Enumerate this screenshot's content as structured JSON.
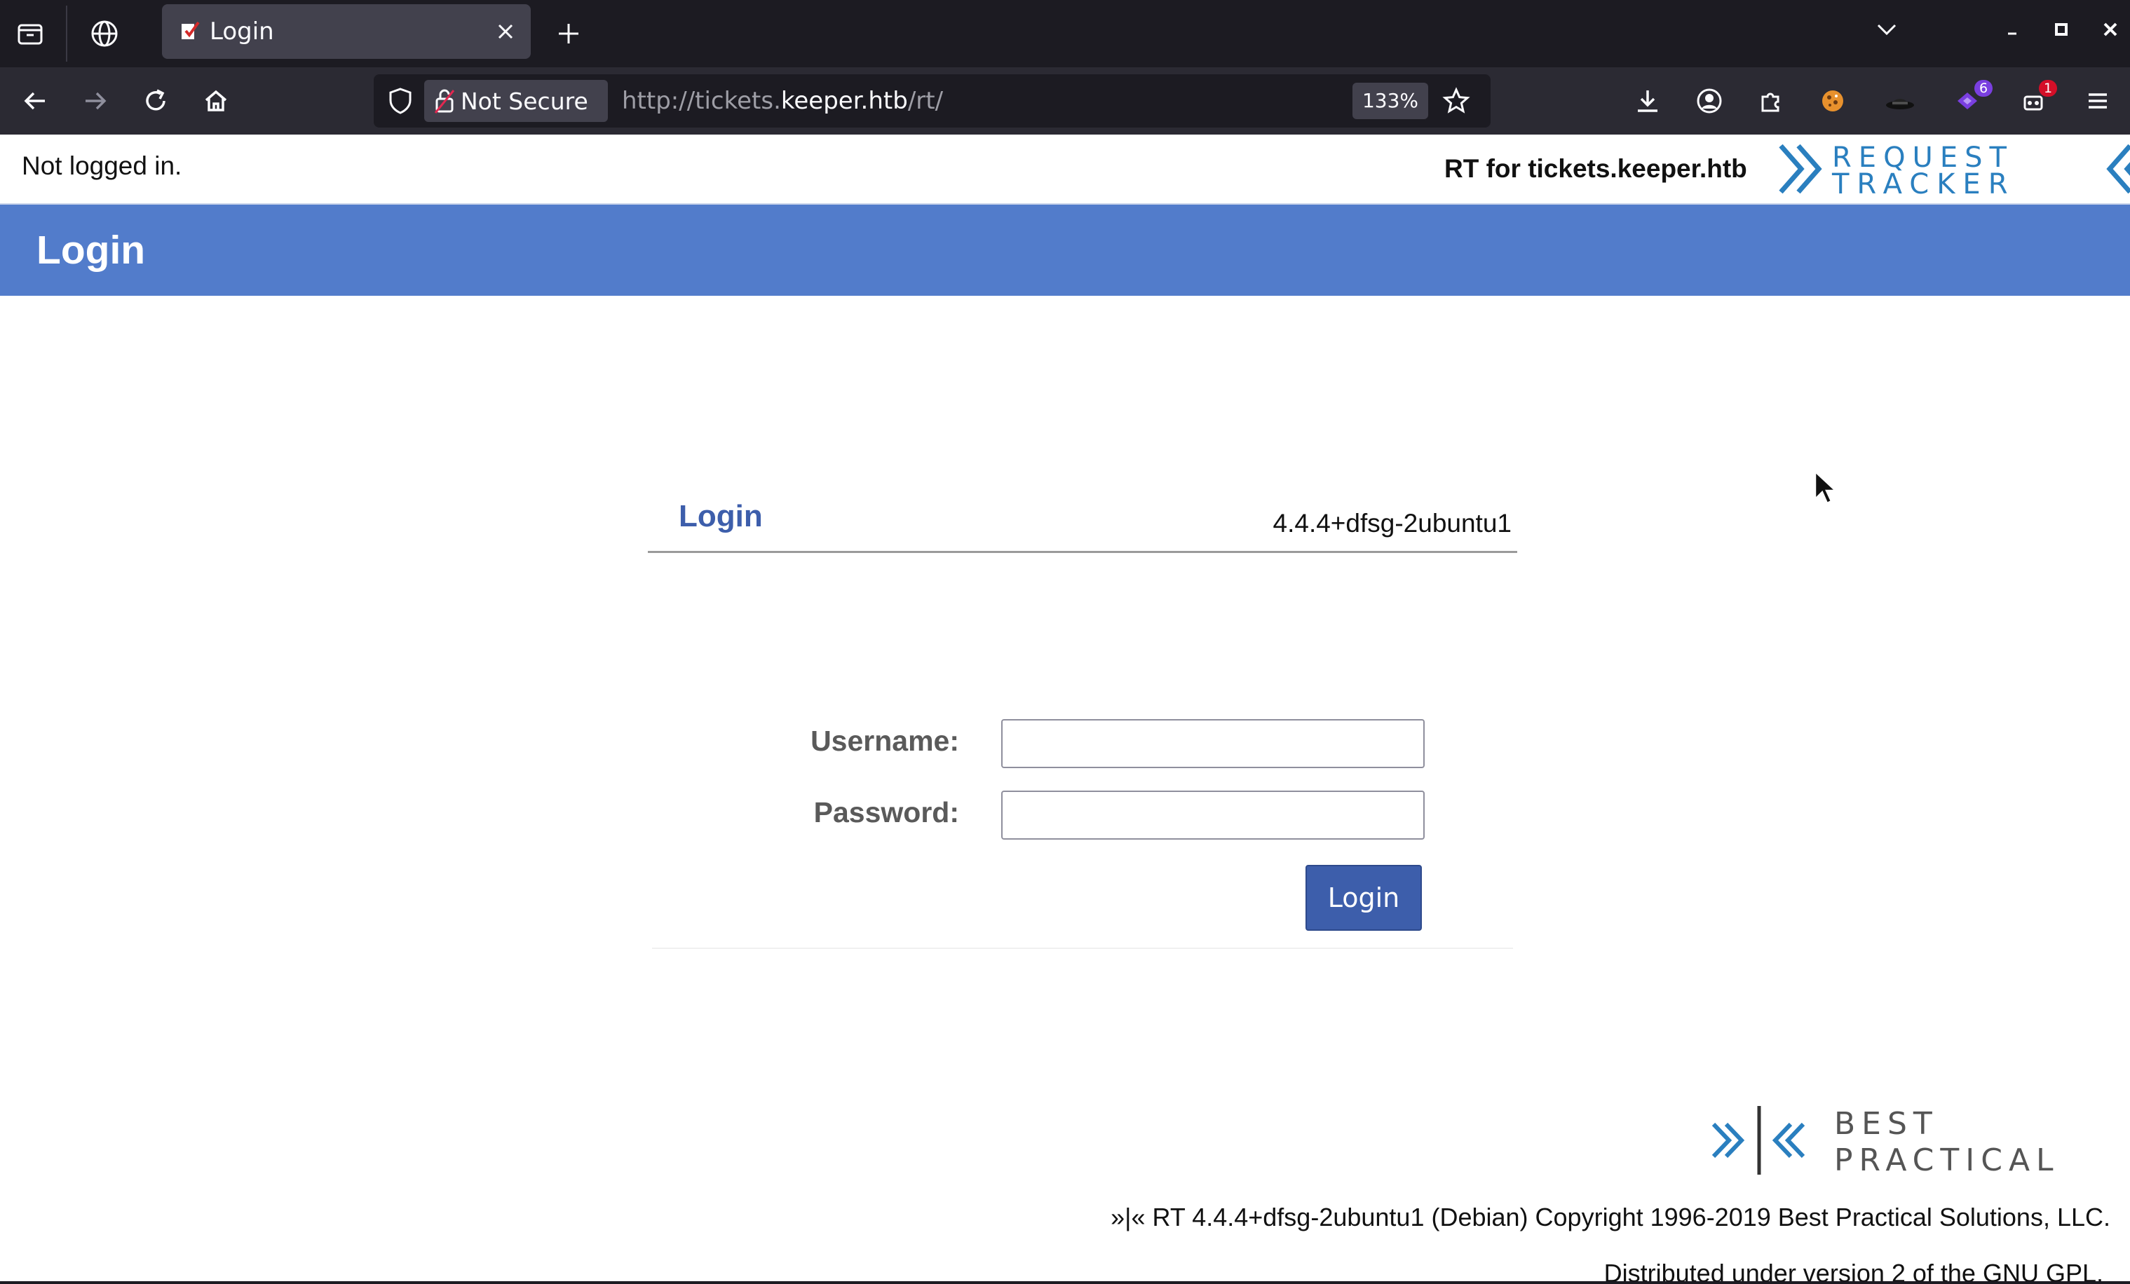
{
  "browser": {
    "tab_title": "Login",
    "security_label": "Not Secure",
    "url_prefix": "http://tickets.",
    "url_domain": "keeper.htb",
    "url_path": "/rt/",
    "zoom": "133%",
    "extension_badges": [
      "6",
      "1"
    ]
  },
  "header": {
    "login_status": "Not logged in.",
    "site_title": "RT for tickets.keeper.htb",
    "logo_text_line1": "REQUEST",
    "logo_text_line2": "TRACKER"
  },
  "page_title": "Login",
  "login_form": {
    "title": "Login",
    "version": "4.4.4+dfsg-2ubuntu1",
    "username_label": "Username:",
    "password_label": "Password:",
    "username_value": "",
    "password_value": "",
    "submit_label": "Login"
  },
  "footer": {
    "logo_line1": "BEST",
    "logo_line2": "PRACTICAL",
    "copyright": "»|« RT 4.4.4+dfsg-2ubuntu1 (Debian) Copyright 1996-2019 Best Practical Solutions, LLC.",
    "license": "Distributed under version 2 of the GNU GPL."
  },
  "colors": {
    "page_bar": "#527ccb",
    "accent": "#3d5eab",
    "logo_blue": "#2a7fbf"
  }
}
